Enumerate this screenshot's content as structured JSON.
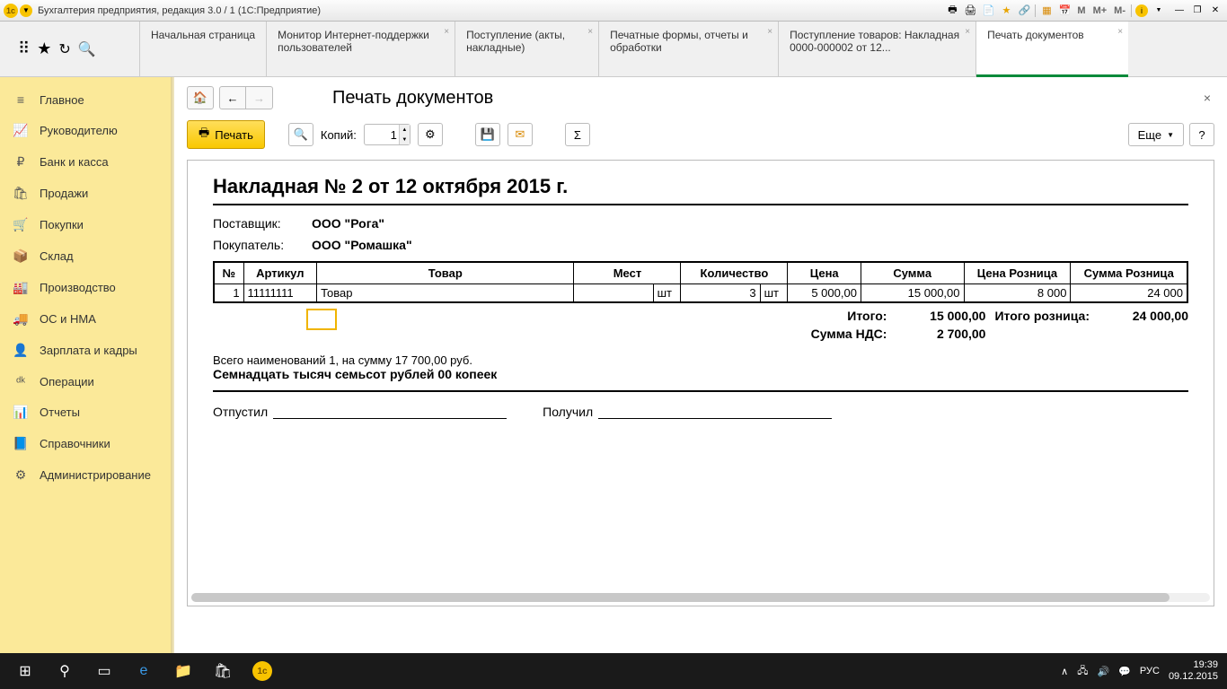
{
  "titlebar": {
    "title": "Бухгалтерия предприятия, редакция 3.0 / 1  (1С:Предприятие)",
    "m": "M",
    "m_plus": "M+",
    "m_minus": "M-"
  },
  "tabs": [
    {
      "label": "Начальная страница",
      "closable": false
    },
    {
      "label": "Монитор Интернет-поддержки пользователей",
      "closable": true
    },
    {
      "label": "Поступление (акты, накладные)",
      "closable": true
    },
    {
      "label": "Печатные формы, отчеты и обработки",
      "closable": true
    },
    {
      "label": "Поступление товаров: Накладная 0000-000002 от 12...",
      "closable": true
    },
    {
      "label": "Печать документов",
      "closable": true,
      "active": true
    }
  ],
  "sidebar": [
    {
      "label": "Главное",
      "icon": "≡"
    },
    {
      "label": "Руководителю",
      "icon": "📈"
    },
    {
      "label": "Банк и касса",
      "icon": "₽"
    },
    {
      "label": "Продажи",
      "icon": "🛍"
    },
    {
      "label": "Покупки",
      "icon": "🛒"
    },
    {
      "label": "Склад",
      "icon": "📦"
    },
    {
      "label": "Производство",
      "icon": "🏭"
    },
    {
      "label": "ОС и НМА",
      "icon": "🚚"
    },
    {
      "label": "Зарплата и кадры",
      "icon": "👤"
    },
    {
      "label": "Операции",
      "icon": "ᵈᵏ"
    },
    {
      "label": "Отчеты",
      "icon": "📊"
    },
    {
      "label": "Справочники",
      "icon": "📘"
    },
    {
      "label": "Администрирование",
      "icon": "⚙"
    }
  ],
  "content": {
    "title": "Печать документов",
    "print_btn": "Печать",
    "copies_label": "Копий:",
    "copies_value": "1",
    "more": "Еще",
    "help": "?"
  },
  "doc": {
    "title": "Накладная № 2 от 12 октября 2015 г.",
    "supplier_label": "Поставщик:",
    "supplier": "ООО \"Рога\"",
    "buyer_label": "Покупатель:",
    "buyer": "ООО \"Ромашка\"",
    "columns": {
      "n": "№",
      "article": "Артикул",
      "product": "Товар",
      "places": "Мест",
      "qty": "Количество",
      "price": "Цена",
      "sum": "Сумма",
      "price_retail": "Цена Розница",
      "sum_retail": "Сумма Розница"
    },
    "row": {
      "n": "1",
      "article": "11111111",
      "product": "Товар",
      "places_unit": "шт",
      "qty": "3",
      "qty_unit": "шт",
      "price": "5 000,00",
      "sum": "15 000,00",
      "price_retail": "8 000",
      "sum_retail": "24 000"
    },
    "totals": {
      "itogo_label": "Итого:",
      "itogo": "15 000,00",
      "itogo_retail_label": "Итого розница:",
      "itogo_retail": "24 000,00",
      "nds_label": "Сумма НДС:",
      "nds": "2 700,00"
    },
    "summary_line": "Всего наименований 1, на сумму 17 700,00 руб.",
    "summary_words": "Семнадцать тысяч семьсот рублей 00 копеек",
    "sign_out": "Отпустил",
    "sign_in": "Получил"
  },
  "taskbar": {
    "lang": "РУС",
    "time": "19:39",
    "date": "09.12.2015"
  }
}
